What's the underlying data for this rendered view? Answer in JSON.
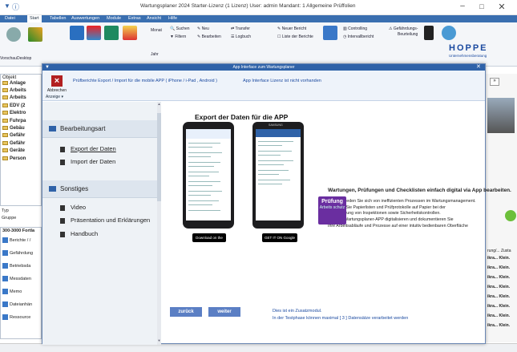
{
  "window": {
    "title": "Wartungsplaner 2024 Starter-Lizenz (1 Lizenz)   User: admin   Mandant: 1 Allgemeine Prüffolien",
    "minimize": "–",
    "maximize": "□",
    "close": "✕"
  },
  "menu": [
    "Datei",
    "Start",
    "Tabellen",
    "Auswertungen",
    "Module",
    "Extras",
    "Ansicht",
    "Hilfe"
  ],
  "ribbon": {
    "left_labels": [
      "Vorschau",
      "Desktop"
    ],
    "monat": "Monat",
    "jahr": "Jahr",
    "suchen": "Suchen",
    "filtern": "Filtern",
    "neu": "Neu",
    "bearbeiten": "Bearbeiten",
    "transfer": "Transfer",
    "logbuch": "Logbuch",
    "neuer_bericht": "Neuer Bericht",
    "liste_berichte": "Liste der Berichte",
    "controlling": "Controlling",
    "intervallbericht": "Intervallbericht",
    "gefaehrdungs": "Gefährdungs-",
    "beurteilung": "Beurteilung",
    "brand": "HOPPE",
    "brand_sub": "Unternehmensberatung"
  },
  "tree": {
    "header": "Objekt",
    "items": [
      "Anlage",
      "Arbeits",
      "Arbeits",
      "EDV (2",
      "Elektro",
      "Fuhrpa",
      "Gebäu",
      "Gefähr",
      "Gefähr",
      "Geräte",
      "Person"
    ]
  },
  "lower_left": {
    "filter1": "Typ",
    "filter2": "Gruppe",
    "header": "300-3000 Fortla",
    "items": [
      "Berichte / /",
      "Gefährdung",
      "Betriebsda",
      "Messdaten",
      "Memo",
      "Dateianhän",
      "Ressource"
    ]
  },
  "right_col": {
    "header1": "rung/...",
    "header2": "Zusta",
    "rows": [
      "ikra...  Klein.",
      "ikra...  Klein.",
      "ikra...  Klein.",
      "ikra...  Klein.",
      "ikra...  Klein.",
      "ikra...  Klein.",
      "ikra...  Klein.",
      "ikra...  Klein."
    ]
  },
  "dialog": {
    "title": "App Interface zum Wartungsplaner",
    "abbrechen": "Abbrechen",
    "anzeige": "Anzeige ▾",
    "ribbon_text1": "Prüfberichte Export / Import für die mobile APP ( iPhone / i-Pad , Android )",
    "ribbon_text2": "App Interface Lizenz ist nicht vorhanden",
    "sidebar": {
      "section1": "Bearbeitungsart",
      "items1": [
        "Export der Daten",
        "Import  der Daten"
      ],
      "section2": "Sonstiges",
      "items2": [
        "Video",
        "Präsentation und Erklärungen",
        "Handbuch"
      ]
    },
    "main_title": "Export der Daten für die APP",
    "store_apple": "Download on the App Store",
    "store_google": "GET IT ON Google play",
    "phone_brand": "SAMSUNG",
    "desc_head": "Wartungen, Prüfungen und Checklisten einfach digital via App bearbeiten.",
    "desc_lines": [
      "Verabschieden Sie sich von ineffizienten Prozessen im Wartungsmanagement.",
      "Ersetzen Sie Papierlisten und Prüfprotokolle auf Papier bei der",
      "Durchführung von Inspektionen sowie Sicherheitskontrollen.",
      "Mit dem Wartungsplaner-APP digitalisieren und dokumentieren Sie",
      "Ihre Arbeitsabläufe und Prozesse auf einer intuitiv bedienbaren Oberfläche"
    ],
    "badge_line1": "Prüfung",
    "badge_line2": "Arbeits schutz",
    "btn_back": "zurück",
    "btn_next": "weiter",
    "demo_line1": "Dies ist ein Zusatzmodul.",
    "demo_line2": "In der Testphase können maximal [ 3 ] Datensätze verarbeitet werden"
  },
  "colors": {
    "accent": "#2f62a8",
    "button": "#5b7fc4",
    "abort": "#b22020",
    "badge": "#6a2ea0"
  }
}
